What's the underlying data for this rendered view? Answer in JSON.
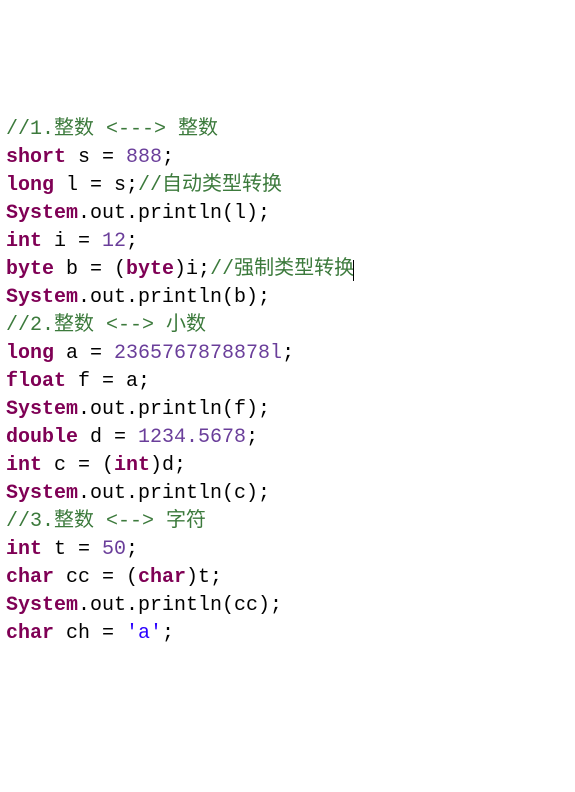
{
  "code": {
    "lines": [
      {
        "tokens": [
          {
            "cls": "comment",
            "t": "//1.整数 <---> 整数"
          }
        ]
      },
      {
        "tokens": [
          {
            "cls": "keyword",
            "t": "short"
          },
          {
            "cls": "plain",
            "t": " s = "
          },
          {
            "cls": "number",
            "t": "888"
          },
          {
            "cls": "plain",
            "t": ";"
          }
        ]
      },
      {
        "tokens": [
          {
            "cls": "keyword",
            "t": "long"
          },
          {
            "cls": "plain",
            "t": " l = s;"
          },
          {
            "cls": "comment",
            "t": "//自动类型转换"
          }
        ]
      },
      {
        "tokens": [
          {
            "cls": "class",
            "t": "System"
          },
          {
            "cls": "plain",
            "t": ".out.println(l);"
          }
        ]
      },
      {
        "tokens": [
          {
            "cls": "plain",
            "t": ""
          }
        ]
      },
      {
        "tokens": [
          {
            "cls": "keyword",
            "t": "int"
          },
          {
            "cls": "plain",
            "t": " i = "
          },
          {
            "cls": "number",
            "t": "12"
          },
          {
            "cls": "plain",
            "t": ";"
          }
        ]
      },
      {
        "tokens": [
          {
            "cls": "keyword",
            "t": "byte"
          },
          {
            "cls": "plain",
            "t": " b = ("
          },
          {
            "cls": "keyword",
            "t": "byte"
          },
          {
            "cls": "plain",
            "t": ")i;"
          },
          {
            "cls": "comment",
            "t": "//强制类型转换"
          },
          {
            "cls": "cursor",
            "t": ""
          }
        ]
      },
      {
        "tokens": [
          {
            "cls": "class",
            "t": "System"
          },
          {
            "cls": "plain",
            "t": ".out.println(b);"
          }
        ]
      },
      {
        "tokens": [
          {
            "cls": "plain",
            "t": ""
          }
        ]
      },
      {
        "tokens": [
          {
            "cls": "comment",
            "t": "//2.整数 <--> 小数"
          }
        ]
      },
      {
        "tokens": [
          {
            "cls": "keyword",
            "t": "long"
          },
          {
            "cls": "plain",
            "t": " a = "
          },
          {
            "cls": "number",
            "t": "2365767878878l"
          },
          {
            "cls": "plain",
            "t": ";"
          }
        ]
      },
      {
        "tokens": [
          {
            "cls": "keyword",
            "t": "float"
          },
          {
            "cls": "plain",
            "t": " f = a;"
          }
        ]
      },
      {
        "tokens": [
          {
            "cls": "class",
            "t": "System"
          },
          {
            "cls": "plain",
            "t": ".out.println(f);"
          }
        ]
      },
      {
        "tokens": [
          {
            "cls": "plain",
            "t": ""
          }
        ]
      },
      {
        "tokens": [
          {
            "cls": "keyword",
            "t": "double"
          },
          {
            "cls": "plain",
            "t": " d = "
          },
          {
            "cls": "number",
            "t": "1234.5678"
          },
          {
            "cls": "plain",
            "t": ";"
          }
        ]
      },
      {
        "tokens": [
          {
            "cls": "keyword",
            "t": "int"
          },
          {
            "cls": "plain",
            "t": " c = ("
          },
          {
            "cls": "keyword",
            "t": "int"
          },
          {
            "cls": "plain",
            "t": ")d;"
          }
        ]
      },
      {
        "tokens": [
          {
            "cls": "class",
            "t": "System"
          },
          {
            "cls": "plain",
            "t": ".out.println(c);"
          }
        ]
      },
      {
        "tokens": [
          {
            "cls": "plain",
            "t": ""
          }
        ]
      },
      {
        "tokens": [
          {
            "cls": "comment",
            "t": "//3.整数 <--> 字符"
          }
        ]
      },
      {
        "tokens": [
          {
            "cls": "keyword",
            "t": "int"
          },
          {
            "cls": "plain",
            "t": " t = "
          },
          {
            "cls": "number",
            "t": "50"
          },
          {
            "cls": "plain",
            "t": ";"
          }
        ]
      },
      {
        "tokens": [
          {
            "cls": "keyword",
            "t": "char"
          },
          {
            "cls": "plain",
            "t": " cc = ("
          },
          {
            "cls": "keyword",
            "t": "char"
          },
          {
            "cls": "plain",
            "t": ")t;"
          }
        ]
      },
      {
        "tokens": [
          {
            "cls": "class",
            "t": "System"
          },
          {
            "cls": "plain",
            "t": ".out.println(cc);"
          }
        ]
      },
      {
        "tokens": [
          {
            "cls": "plain",
            "t": ""
          }
        ]
      },
      {
        "tokens": [
          {
            "cls": "keyword",
            "t": "char"
          },
          {
            "cls": "plain",
            "t": " ch = "
          },
          {
            "cls": "char",
            "t": "'a'"
          },
          {
            "cls": "plain",
            "t": ";"
          }
        ]
      }
    ]
  }
}
